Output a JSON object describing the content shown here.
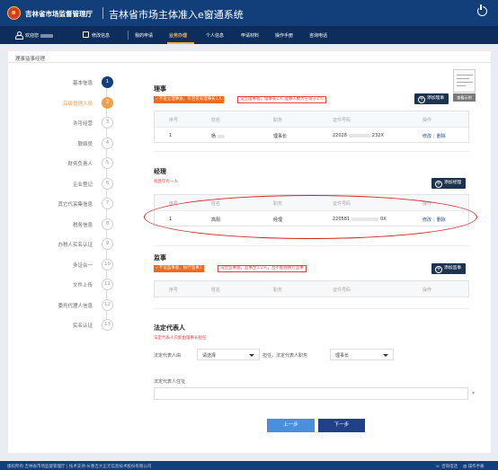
{
  "header": {
    "org": "吉林省市场监督管理厅",
    "system": "吉林省市场主体准入e窗通系统"
  },
  "nav": {
    "welcome": "欢迎您",
    "edit": "修改信息",
    "items": [
      "我的申请",
      "业务办理",
      "个人信息",
      "申请材料",
      "操作手册",
      "咨询电话"
    ]
  },
  "panel_title": "理事监事经理",
  "steps": [
    {
      "label": "基本信息",
      "num": "1",
      "state": "done"
    },
    {
      "label": "高级管理人员",
      "num": "2",
      "state": "current"
    },
    {
      "label": "许可经营",
      "num": "3"
    },
    {
      "label": "联络员",
      "num": "4"
    },
    {
      "label": "财务负责人",
      "num": "5"
    },
    {
      "label": "企业登记",
      "num": "6"
    },
    {
      "label": "其它代采集信息",
      "num": "7"
    },
    {
      "label": "税务信息",
      "num": "8"
    },
    {
      "label": "办税人实名认证",
      "num": "9"
    },
    {
      "label": "多证合一",
      "num": "10"
    },
    {
      "label": "文件上传",
      "num": "11"
    },
    {
      "label": "委托代理人信息",
      "num": "12"
    },
    {
      "label": "实名认证",
      "num": "13"
    }
  ],
  "board": {
    "title": "理事",
    "warn1": "✓不设立理事会，有且仅有理事长1人",
    "warn2": "设立理事会，理事长1人,理事人数大于等于2人",
    "add": "添加理事",
    "thumb_btn": "查看示例",
    "columns": [
      "序号",
      "姓名",
      "职务",
      "证件号码",
      "操作"
    ],
    "rows": [
      {
        "no": "1",
        "name": "杨",
        "role": "理事长",
        "id_pre": "22028",
        "id_suf": "232X"
      }
    ]
  },
  "manager": {
    "title": "经理",
    "note": "有且仅有一人",
    "add": "添加经理",
    "columns": [
      "序号",
      "姓名",
      "职务",
      "证件号码",
      "操作"
    ],
    "rows": [
      {
        "no": "1",
        "name": "高阳",
        "role": "经理",
        "id_pre": "220581",
        "id_suf": "0X"
      }
    ]
  },
  "supervisor": {
    "title": "监事",
    "warn1": "✓不设监事会，执行监事1",
    "warn2": "设立监事会，监事至少2人，且不能有执行监事",
    "add": "添加监事",
    "columns": [
      "序号",
      "姓名",
      "职务",
      "证件号码",
      "操作"
    ]
  },
  "ops": {
    "edit": "修改",
    "delete": "删除",
    "sep": "|"
  },
  "legal": {
    "title": "法定代表人",
    "note": "法定代表人只能由理事长担任",
    "by_label": "法定代表人由",
    "by_value": "请选择",
    "serve_label": "担任，法定代表人职务",
    "serve_value": "理事长",
    "addr_label": "法定代表人住址"
  },
  "buttons": {
    "prev": "上一步",
    "next": "下一步"
  },
  "footer": {
    "left": "版权所有:吉林省市场监督管理厅 | 技术支持:长春吉大正元信息技术股份有限公司",
    "help": "咨询电话",
    "manual": "操作手册"
  }
}
